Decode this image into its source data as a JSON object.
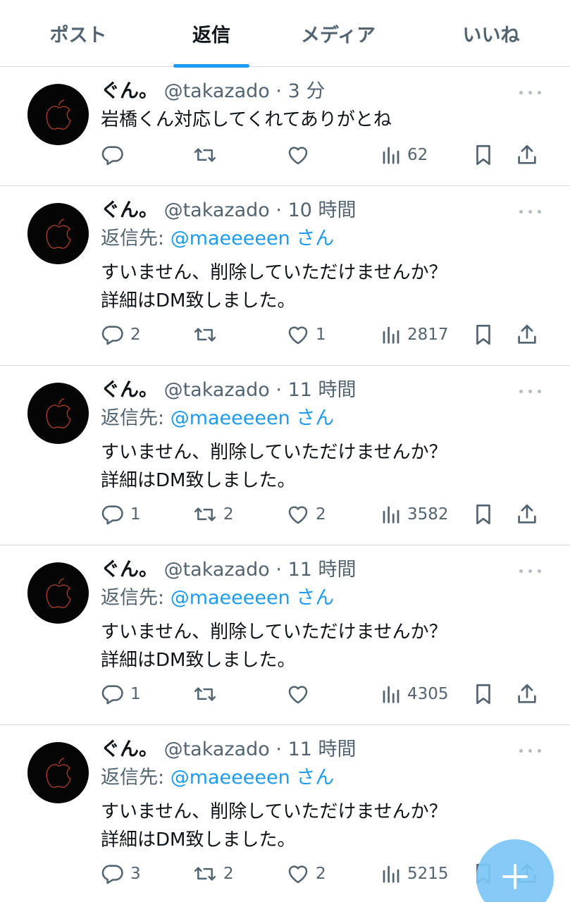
{
  "tabs": [
    {
      "label": "ポスト"
    },
    {
      "label": "返信"
    },
    {
      "label": "メディア"
    },
    {
      "label": "いいね"
    }
  ],
  "active_tab": "返信",
  "colors": {
    "accent": "#1d9bf0",
    "text": "#0f1419",
    "muted": "#536471",
    "divider": "#d6dadd"
  },
  "posts": [
    {
      "name": "ぐん。",
      "handle": "@takazado",
      "dot": "·",
      "time": "3 分",
      "reply_label": "",
      "reply_handle": "",
      "reply_suffix": "",
      "lines": [
        "岩橋くん対応してくれてありがとね"
      ],
      "replies": "",
      "reposts": "",
      "likes": "",
      "views": "62"
    },
    {
      "name": "ぐん。",
      "handle": "@takazado",
      "dot": "·",
      "time": "10 時間",
      "reply_label": "返信先: ",
      "reply_handle": "@maeeeeen",
      "reply_suffix": " さん",
      "lines": [
        "すいません、削除していただけませんか？",
        "詳細はDM致しました。"
      ],
      "replies": "2",
      "reposts": "",
      "likes": "1",
      "views": "2817"
    },
    {
      "name": "ぐん。",
      "handle": "@takazado",
      "dot": "·",
      "time": "11 時間",
      "reply_label": "返信先: ",
      "reply_handle": "@maeeeeen",
      "reply_suffix": " さん",
      "lines": [
        "すいません、削除していただけませんか？",
        "詳細はDM致しました。"
      ],
      "replies": "1",
      "reposts": "2",
      "likes": "2",
      "views": "3582"
    },
    {
      "name": "ぐん。",
      "handle": "@takazado",
      "dot": "·",
      "time": "11 時間",
      "reply_label": "返信先: ",
      "reply_handle": "@maeeeeen",
      "reply_suffix": " さん",
      "lines": [
        "すいません、削除していただけませんか？",
        "詳細はDM致しました。"
      ],
      "replies": "1",
      "reposts": "",
      "likes": "",
      "views": "4305"
    },
    {
      "name": "ぐん。",
      "handle": "@takazado",
      "dot": "·",
      "time": "11 時間",
      "reply_label": "返信先: ",
      "reply_handle": "@maeeeeen",
      "reply_suffix": " さん",
      "lines": [
        "すいません、削除していただけませんか？",
        "詳細はDM致しました。"
      ],
      "replies": "3",
      "reposts": "2",
      "likes": "2",
      "views": "5215"
    }
  ],
  "icons": {
    "reply": "comment-bubble-icon",
    "repost": "repost-arrows-icon",
    "like": "heart-icon",
    "views": "bar-chart-icon",
    "bookmark": "bookmark-icon",
    "share": "share-upload-icon",
    "more": "more-dots-icon",
    "compose": "compose-plus-icon"
  }
}
